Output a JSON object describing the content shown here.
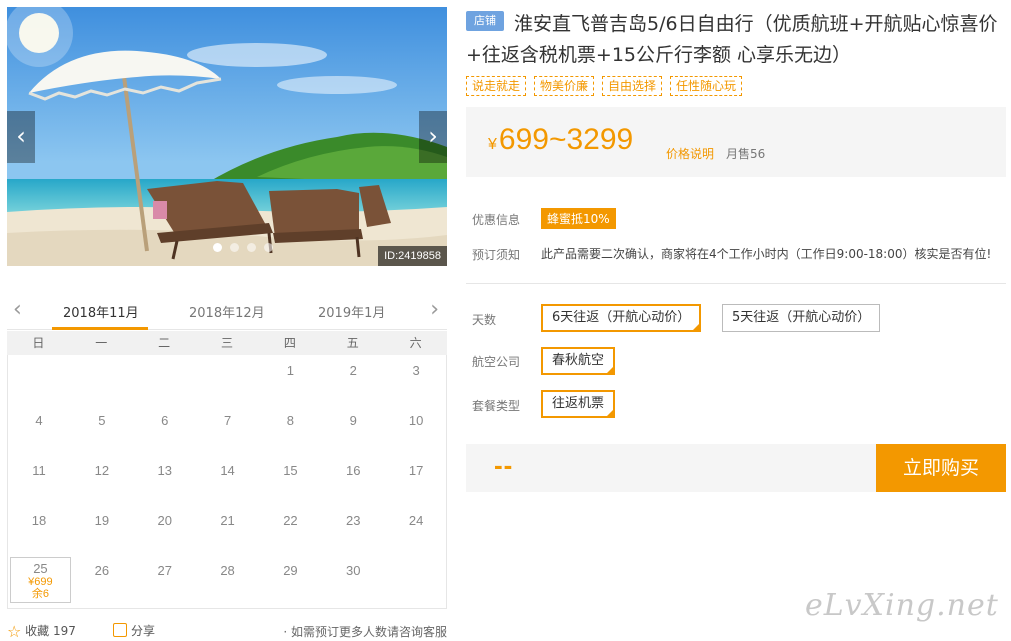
{
  "gallery": {
    "photo_id": "ID:2419858",
    "prev_icon": "chevron-left-icon",
    "next_icon": "chevron-right-icon",
    "dot_count": 4,
    "active_dot": 1
  },
  "calendar": {
    "months": [
      "2018年11月",
      "2018年12月",
      "2019年1月"
    ],
    "weekdays": [
      "日",
      "一",
      "二",
      "三",
      "四",
      "五",
      "六"
    ],
    "rows": [
      [
        "",
        "",
        "",
        "",
        "1",
        "2",
        "3"
      ],
      [
        "4",
        "5",
        "6",
        "7",
        "8",
        "9",
        "10"
      ],
      [
        "11",
        "12",
        "13",
        "14",
        "15",
        "16",
        "17"
      ],
      [
        "18",
        "19",
        "20",
        "21",
        "22",
        "23",
        "24"
      ],
      [
        "25",
        "26",
        "27",
        "28",
        "29",
        "30",
        ""
      ]
    ],
    "available": {
      "day": "25",
      "price": "¥699",
      "stock": "余6"
    }
  },
  "footer": {
    "favorite_label": "收藏",
    "favorite_count": "197",
    "share_label": "分享",
    "note": "· 如需预订更多人数请咨询客服"
  },
  "product": {
    "shop_badge": "店铺",
    "title": "淮安直飞普吉岛5/6日自由行（优质航班+开航贴心惊喜价+往返含税机票+15公斤行李额 心享乐无边）",
    "tags": [
      "说走就走",
      "物美价廉",
      "自由选择",
      "任性随心玩"
    ],
    "currency": "¥",
    "price_range": "699~3299",
    "price_note": "价格说明",
    "monthly_sales": "月售56"
  },
  "info": {
    "discount_label": "优惠信息",
    "coupon": "蜂蜜抵10%",
    "booking_label": "预订须知",
    "booking_text": "此产品需要二次确认，商家将在4个工作小时内（工作日9:00-18:00）核实是否有位!"
  },
  "options": {
    "days_label": "天数",
    "days": [
      "6天往返（开航心动价）",
      "5天往返（开航心动价）"
    ],
    "airline_label": "航空公司",
    "airline": "春秋航空",
    "package_label": "套餐类型",
    "package": "往返机票"
  },
  "buy": {
    "total": "--",
    "button": "立即购买"
  },
  "watermark": "eLvXing.net",
  "colors": {
    "accent": "#f39800",
    "badge": "#6fa3e0"
  }
}
